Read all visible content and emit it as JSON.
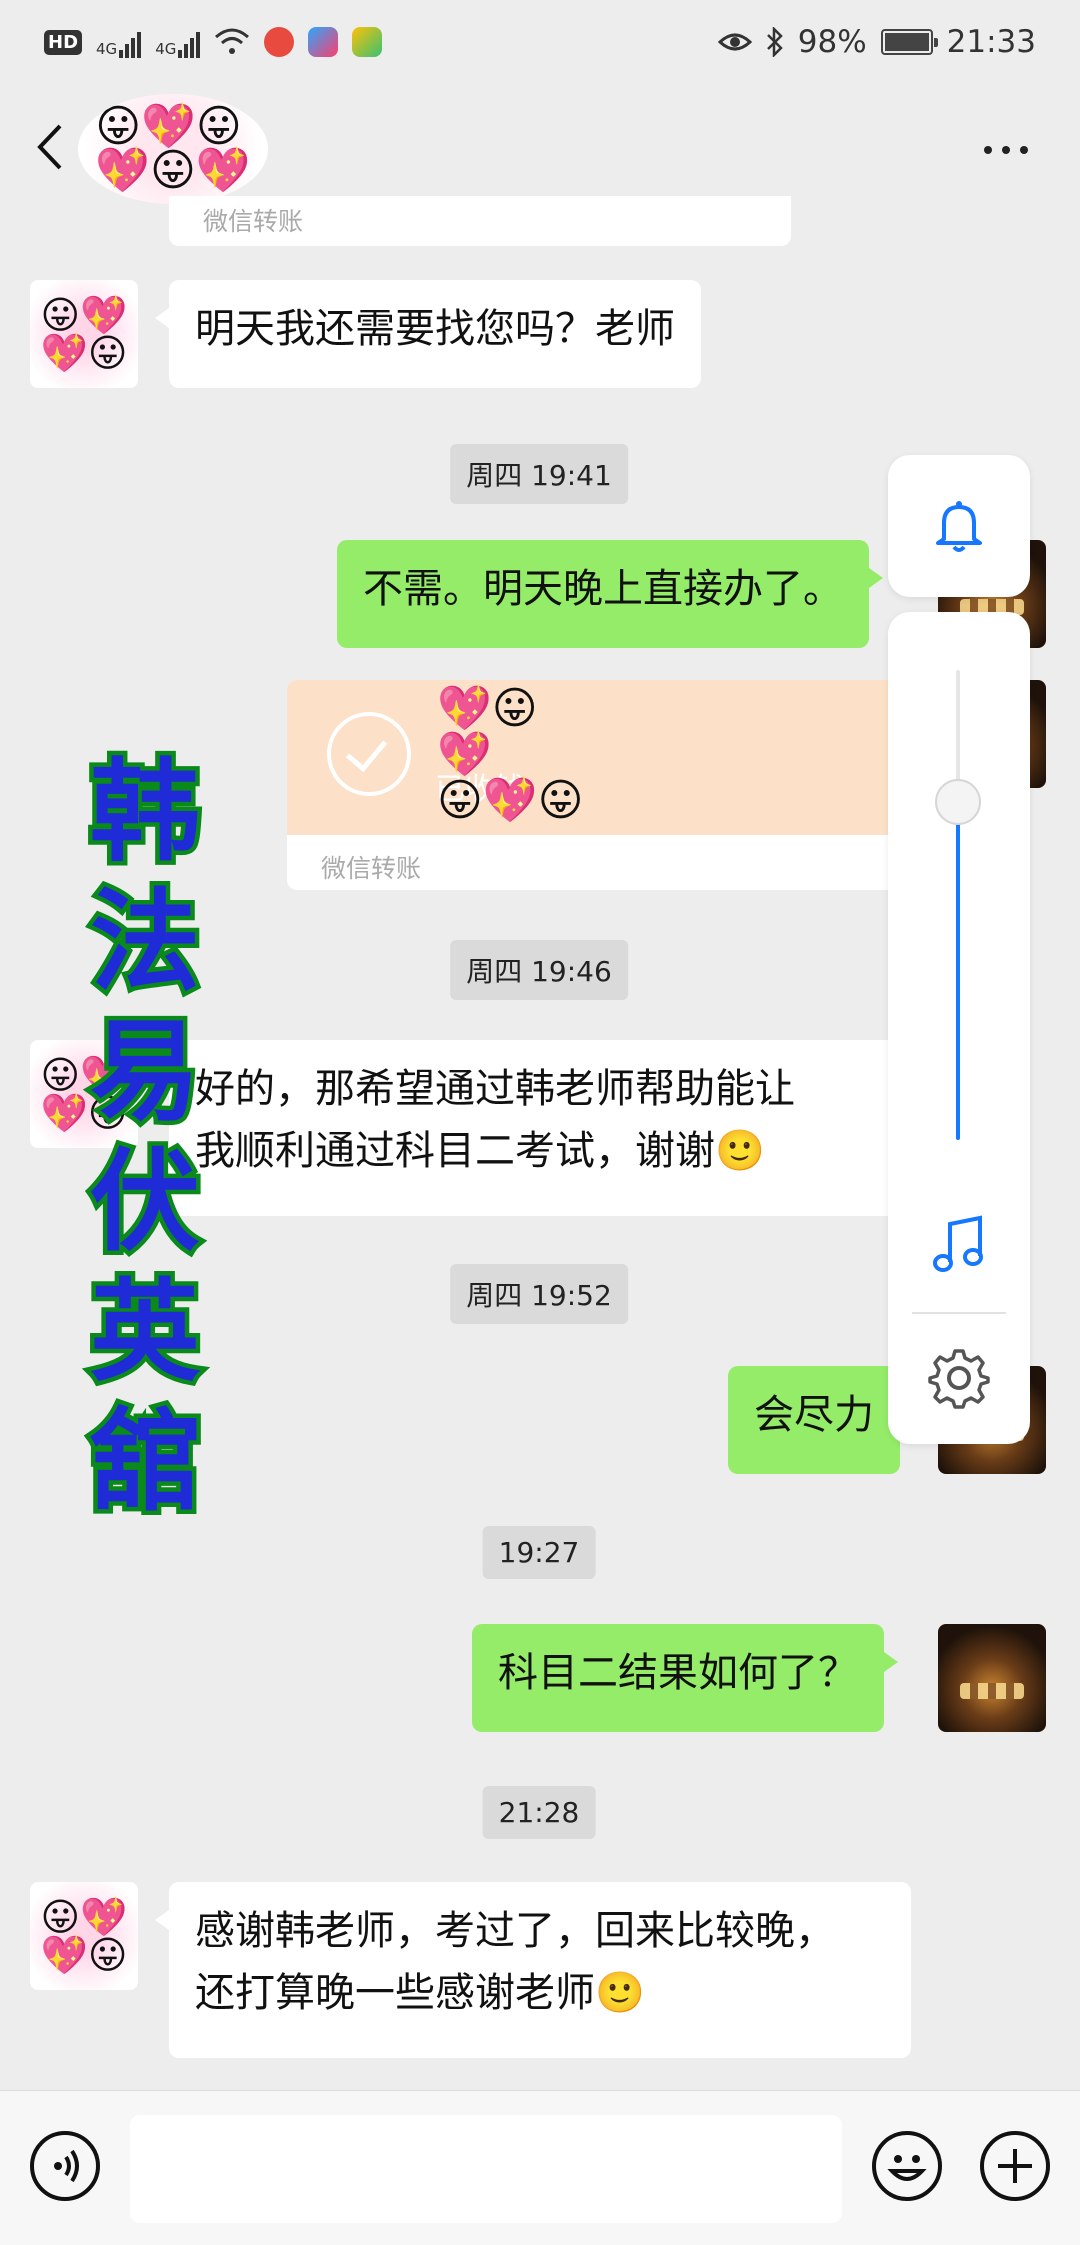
{
  "status_bar": {
    "left_badges": [
      "HD",
      "4G",
      "4G"
    ],
    "battery": "98%",
    "time": "21:33"
  },
  "header": {
    "title": ""
  },
  "watermark": {
    "chars": [
      "韩",
      "法",
      "易",
      "伏",
      "英",
      "舘"
    ]
  },
  "messages": {
    "transfer_partial_caption": "微信转账",
    "m1": "明天我还需要找您吗？老师",
    "t1": "周四 19:41",
    "m2": "不需。明天晚上直接办了。",
    "transfer": {
      "status": "已收钱",
      "caption": "微信转账"
    },
    "t2": "周四 19:46",
    "m3_line1": "好的，那希望通过韩老师帮助能让",
    "m3_line2": "我顺利通过科目二考试，谢谢🙂",
    "t3": "周四 19:52",
    "m4": "会尽力",
    "t4": "19:27",
    "m5": "科目二结果如何了？",
    "t5": "21:28",
    "m6_line1": "感谢韩老师，考过了，回来比较晚，",
    "m6_line2": "还打算晚一些感谢老师🙂"
  },
  "floating_panel": {
    "volume_level": 0.72,
    "accent": "#1677ff"
  },
  "icons": [
    "back-arrow-icon",
    "more-icon",
    "bell-icon",
    "music-note-icon",
    "gear-icon",
    "voice-icon",
    "emoji-icon",
    "plus-icon"
  ],
  "colors": {
    "bg": "#ededed",
    "sent_bubble": "#95ec69",
    "received_bubble": "#ffffff",
    "transfer": "#fce1c8"
  }
}
